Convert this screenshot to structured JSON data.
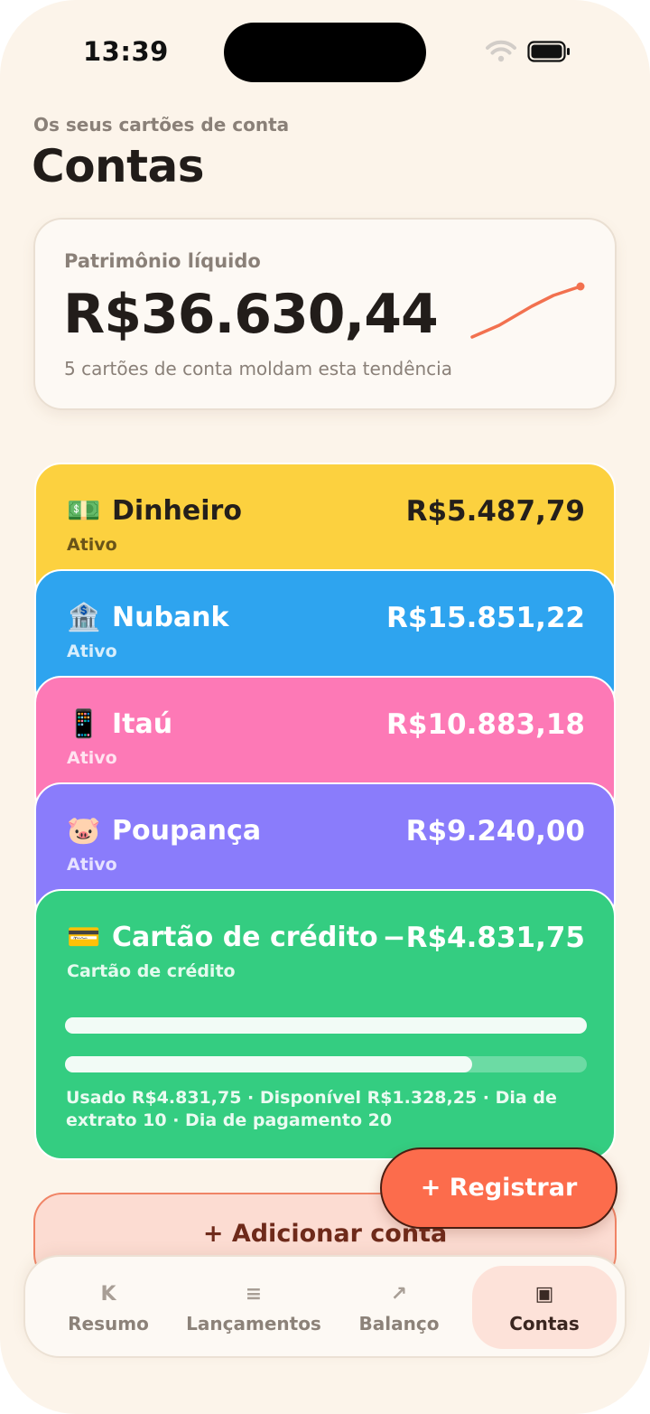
{
  "status_bar": {
    "time": "13:39"
  },
  "header": {
    "subtitle": "Os seus cartões de conta",
    "title": "Contas"
  },
  "net_worth": {
    "label": "Patrimônio líquido",
    "value": "R$36.630,44",
    "caption": "5 cartões de conta moldam esta tendência",
    "trend_color": "#f2714f"
  },
  "accounts": [
    {
      "icon": "💵",
      "icon_name": "cash-icon",
      "name": "Dinheiro",
      "balance": "R$5.487,79",
      "status": "Ativo",
      "color": "#fcd13f"
    },
    {
      "icon": "🏦",
      "icon_name": "bank-icon",
      "name": "Nubank",
      "balance": "R$15.851,22",
      "status": "Ativo",
      "color": "#2ea4ef"
    },
    {
      "icon": "📱",
      "icon_name": "phone-icon",
      "name": "Itaú",
      "balance": "R$10.883,18",
      "status": "Ativo",
      "color": "#fd79b6"
    },
    {
      "icon": "🐷",
      "icon_name": "piggy-bank-icon",
      "name": "Poupança",
      "balance": "R$9.240,00",
      "status": "Ativo",
      "color": "#8a7cfb"
    },
    {
      "icon": "💳",
      "icon_name": "credit-card-icon",
      "name": "Cartão de crédito",
      "balance": "−R$4.831,75",
      "status": "Cartão de crédito",
      "color": "#34cd81",
      "bars": [
        1.0,
        0.78
      ],
      "details": "Usado R$4.831,75 · Disponível R$1.328,25 · Dia de extrato 10 · Dia de pagamento 20"
    }
  ],
  "add_account": {
    "label": "+ Adicionar conta"
  },
  "fab": {
    "label": "+ Registrar"
  },
  "tabs": [
    {
      "glyph": "K",
      "label": "Resumo",
      "icon_name": "summary-icon"
    },
    {
      "glyph": "≡",
      "label": "Lançamentos",
      "icon_name": "list-icon"
    },
    {
      "glyph": "↗",
      "label": "Balanço",
      "icon_name": "trend-arrow-icon"
    },
    {
      "glyph": "▣",
      "label": "Contas",
      "icon_name": "accounts-icon",
      "active": true
    }
  ],
  "colors": {
    "background": "#fcf4ea",
    "accent": "#fc6c4c",
    "active_tab": "#fde2d9"
  }
}
